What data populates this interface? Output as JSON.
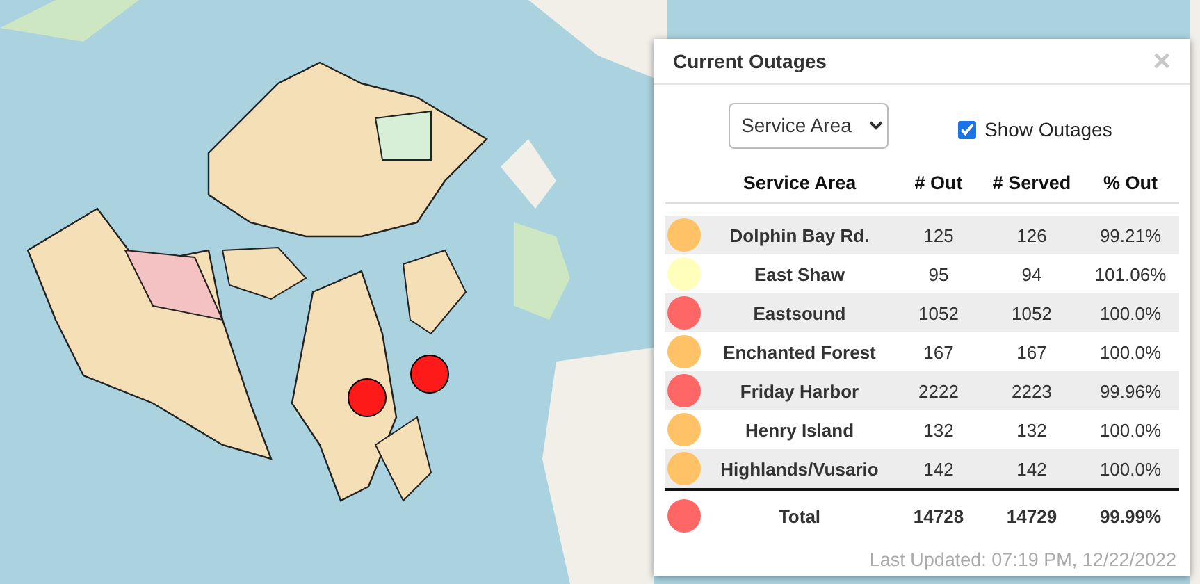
{
  "map": {
    "kind": "picture",
    "markers": [
      {
        "color": "#ff1a1a"
      },
      {
        "color": "#ff1a1a"
      }
    ]
  },
  "panel": {
    "title": "Current Outages",
    "close": "×",
    "group_by": {
      "value": "Service Area"
    },
    "show_outages": {
      "label": "Show Outages",
      "checked": true
    },
    "columns": [
      "Service Area",
      "# Out",
      "# Served",
      "% Out"
    ],
    "rows": [
      {
        "color": "#ffc266",
        "name": "Dolphin Bay Rd.",
        "out": "125",
        "served": "126",
        "pct": "99.21%"
      },
      {
        "color": "#ffffbb",
        "name": "East Shaw",
        "out": "95",
        "served": "94",
        "pct": "101.06%"
      },
      {
        "color": "#ff6666",
        "name": "Eastsound",
        "out": "1052",
        "served": "1052",
        "pct": "100.0%"
      },
      {
        "color": "#ffc266",
        "name": "Enchanted Forest",
        "out": "167",
        "served": "167",
        "pct": "100.0%"
      },
      {
        "color": "#ff6666",
        "name": "Friday Harbor",
        "out": "2222",
        "served": "2223",
        "pct": "99.96%"
      },
      {
        "color": "#ffc266",
        "name": "Henry Island",
        "out": "132",
        "served": "132",
        "pct": "100.0%"
      },
      {
        "color": "#ffc266",
        "name": "Highlands/Vusario",
        "out": "142",
        "served": "142",
        "pct": "100.0%"
      }
    ],
    "total": {
      "color": "#ff6666",
      "name": "Total",
      "out": "14728",
      "served": "14729",
      "pct": "99.99%"
    },
    "last_updated": "Last Updated: 07:19 PM, 12/22/2022"
  }
}
